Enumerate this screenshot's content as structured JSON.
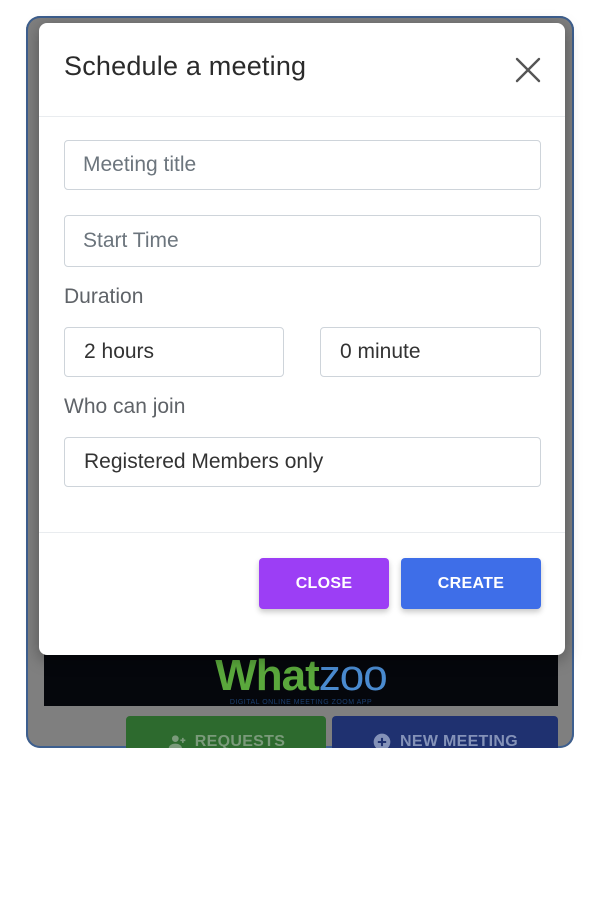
{
  "modal": {
    "title": "Schedule a meeting",
    "meeting_title_placeholder": "Meeting title",
    "start_time_placeholder": "Start Time",
    "duration_label": "Duration",
    "duration_hours": "2 hours",
    "duration_minutes": "0 minute",
    "who_can_join_label": "Who can join",
    "who_can_join_value": "Registered Members only",
    "close_label": "CLOSE",
    "create_label": "CREATE"
  },
  "background": {
    "logo_part1": "What",
    "logo_part2": "zoo",
    "tagline": "DIGITAL ONLINE MEETING ZOOM APP",
    "requests_label": "REQUESTS",
    "new_meeting_label": "NEW MEETING"
  },
  "colors": {
    "close_button": "#9c3ef5",
    "create_button": "#3e6ee8",
    "overlay": "#7f7f7f"
  },
  "icons": [
    "close-icon",
    "add-user-icon",
    "plus-circle-icon"
  ]
}
